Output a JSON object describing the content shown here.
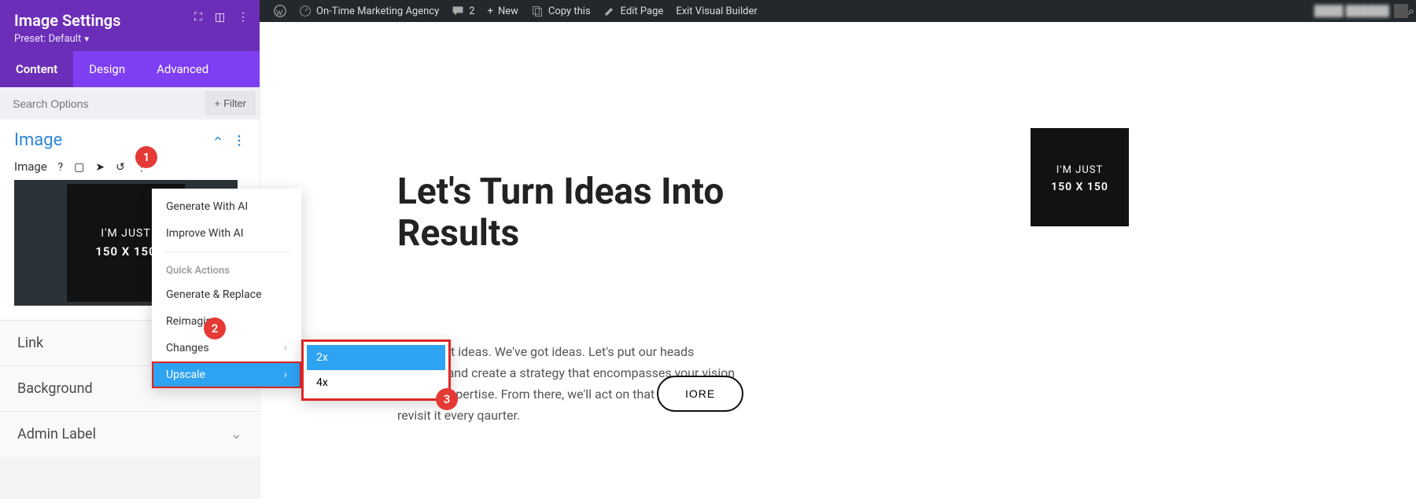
{
  "adminbar": {
    "site": "On-Time Marketing Agency",
    "comments": "2",
    "new": "New",
    "copy": "Copy this",
    "edit": "Edit Page",
    "exit": "Exit Visual Builder"
  },
  "panel": {
    "title": "Image Settings",
    "preset_label": "Preset:",
    "preset_value": "Default"
  },
  "tabs": {
    "content": "Content",
    "design": "Design",
    "advanced": "Advanced"
  },
  "search": {
    "placeholder": "Search Options",
    "filter": "Filter"
  },
  "section": {
    "image_title": "Image"
  },
  "imagerow": {
    "label": "Image"
  },
  "thumb": {
    "line1": "I'M JUST",
    "line2": "150 X 150"
  },
  "ai_button": "AI",
  "ai_menu": {
    "generate": "Generate With AI",
    "improve": "Improve With AI",
    "quick": "Quick Actions",
    "genreplace": "Generate & Replace",
    "reimagine": "Reimagine",
    "changes": "Changes",
    "upscale": "Upscale"
  },
  "submenu": {
    "x2": "2x",
    "x4": "4x"
  },
  "accordion": {
    "link": "Link",
    "background": "Background",
    "admin": "Admin Label"
  },
  "annotations": {
    "b1": "1",
    "b2": "2",
    "b3": "3"
  },
  "page": {
    "heading": "Let's Turn Ideas Into Results",
    "para": "You've got ideas. We've got ideas. Let's put our heads together and create a strategy that encompasses your vision and our expertise. From there, we'll act on that strategy and revisit it every qaurter.",
    "button": "IORE",
    "tile_line1": "I'M JUST",
    "tile_line2": "150 X 150"
  }
}
